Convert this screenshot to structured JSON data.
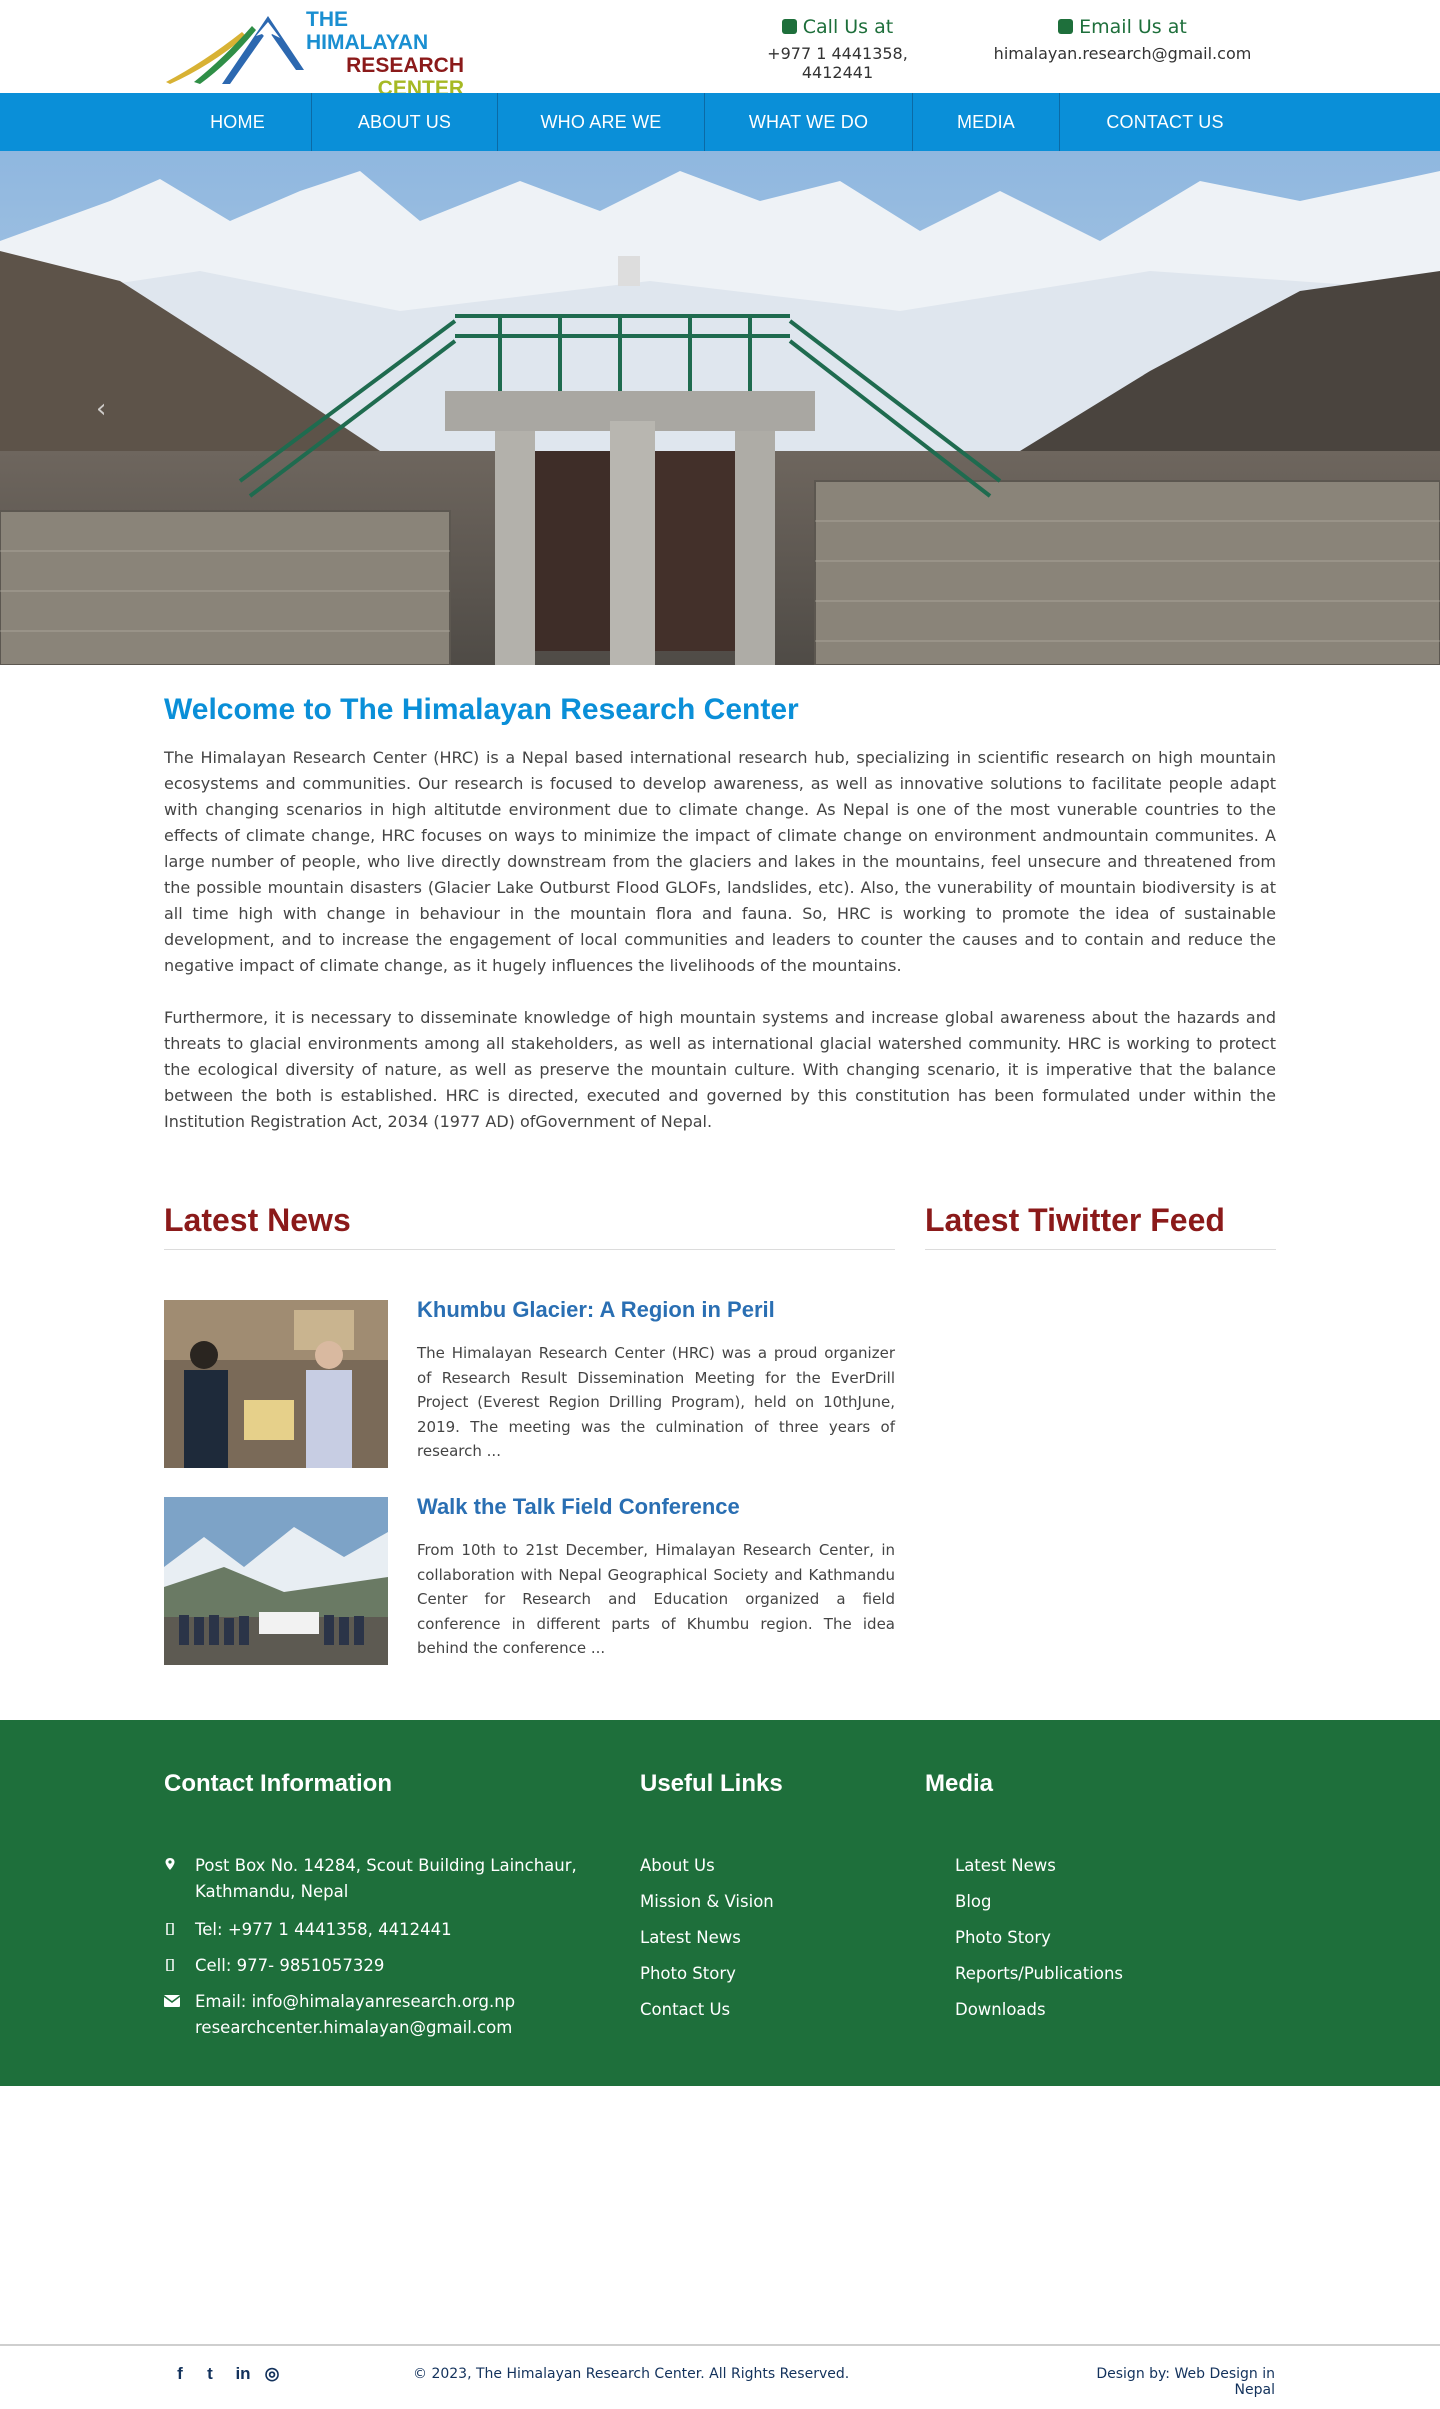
{
  "header": {
    "logo": {
      "line1": "THE HIMALAYAN",
      "line2": "RESEARCH",
      "line3": "CENTER"
    },
    "call": {
      "label": "Call Us at",
      "value": "+977 1 4441358, 4412441"
    },
    "email": {
      "label": "Email Us at",
      "value": "himalayan.research@gmail.com"
    }
  },
  "nav": {
    "items": [
      {
        "label": "HOME"
      },
      {
        "label": "ABOUT US"
      },
      {
        "label": "WHO ARE WE"
      },
      {
        "label": "WHAT WE DO"
      },
      {
        "label": "MEDIA"
      },
      {
        "label": "CONTACT US"
      }
    ]
  },
  "hero": {
    "prev_glyph": "‹"
  },
  "welcome": {
    "title": "Welcome to The Himalayan Research Center",
    "paragraph1": "The Himalayan Research Center (HRC) is a Nepal based international research hub, specializing in scientific research on high mountain ecosystems and communities. Our research is focused to develop awareness, as well as innovative solutions to facilitate people adapt with changing scenarios in high altitutde environment due to climate change. As Nepal is one of the most vunerable countries to the effects of climate change, HRC focuses on ways to minimize the impact of climate change on environment andmountain communites. A large number of people, who live directly downstream from the glaciers and lakes in the mountains, feel unsecure and threatened from the possible mountain disasters (Glacier Lake Outburst Flood GLOFs, landslides, etc). Also, the vunerability of mountain biodiversity is at all time high with change in behaviour in the mountain flora and fauna. So, HRC is working to promote the idea of sustainable development, and to increase the engagement of local communities and leaders to counter the causes and to contain and reduce the negative impact of climate change, as it hugely influences the livelihoods of the mountains.",
    "paragraph2": "Furthermore, it is necessary to disseminate knowledge of high mountain systems and increase global awareness about the hazards and threats to glacial environments among all stakeholders, as well as international glacial watershed community. HRC is working to protect the ecological diversity of nature, as well as preserve the mountain culture. With changing scenario, it is imperative that the balance between the both is established. HRC is directed, executed and governed by this constitution has been formulated under within the Institution Registration Act, 2034 (1977 AD) ofGovernment of Nepal."
  },
  "news": {
    "heading": "Latest News",
    "items": [
      {
        "title": "Khumbu Glacier: A Region in Peril",
        "excerpt": "The Himalayan Research Center (HRC) was a proud organizer of Research Result Dissemination Meeting for the EverDrill Project (Everest Region Drilling Program), held on 10thJune, 2019. The meeting was the culmination of three years of research ..."
      },
      {
        "title": "Walk the Talk Field Conference",
        "excerpt": "From 10th to 21st December, Himalayan Research Center, in collaboration with Nepal Geographical Society and Kathmandu Center for Research and Education organized a field conference in different parts of Khumbu region. The idea behind the conference ..."
      }
    ]
  },
  "twitter": {
    "heading": "Latest Tiwitter Feed"
  },
  "footer": {
    "contact": {
      "heading": "Contact Information",
      "address_line1": "Post Box No. 14284, Scout Building Lainchaur,",
      "address_line2": "Kathmandu, Nepal",
      "tel": "Tel: +977 1 4441358, 4412441",
      "cell": "Cell: 977- 9851057329",
      "email_line1": "Email: info@himalayanresearch.org.np",
      "email_line2": "researchcenter.himalayan@gmail.com"
    },
    "useful_links": {
      "heading": "Useful Links",
      "items": [
        "About Us",
        "Mission & Vision",
        "Latest News",
        "Photo Story",
        "Contact Us"
      ]
    },
    "media": {
      "heading": "Media",
      "items": [
        "Latest News",
        "Blog",
        "Photo Story",
        "Reports/Publications",
        "Downloads"
      ]
    }
  },
  "bottom": {
    "social": [
      {
        "icon": "facebook-icon",
        "glyph": "f"
      },
      {
        "icon": "twitter-icon",
        "glyph": "t"
      },
      {
        "icon": "linkedin-icon",
        "glyph": "in"
      },
      {
        "icon": "instagram-icon",
        "glyph": "◎"
      }
    ],
    "copyright": "© 2023, The Himalayan Research Center. All Rights Reserved.",
    "credit": "Design by: Web Design in Nepal"
  },
  "colors": {
    "primary_blue": "#0a8fd8",
    "heading_red": "#8b1a1a",
    "footer_green": "#1e6f3b",
    "news_title_blue": "#2a6fb3"
  }
}
